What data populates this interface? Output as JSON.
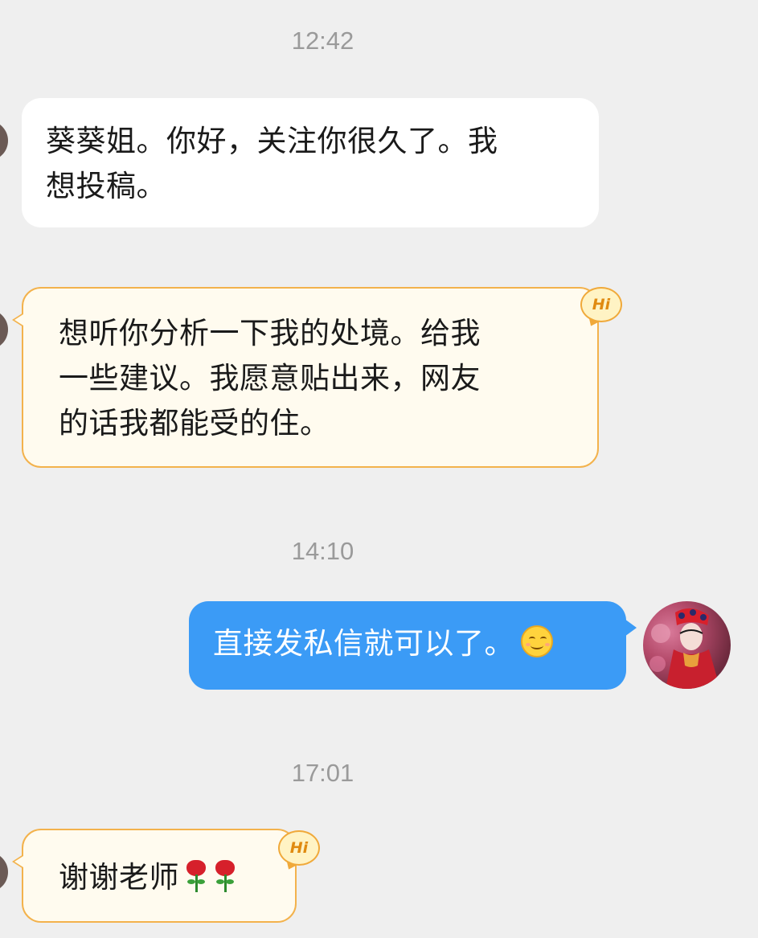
{
  "timestamps": [
    "12:42",
    "14:10",
    "17:01"
  ],
  "messages": [
    {
      "side": "left",
      "style": "white",
      "lines": [
        "葵葵姐。你好，关注你很久了。我",
        "想投稿。"
      ]
    },
    {
      "side": "left",
      "style": "cream",
      "badge": "Hi",
      "lines": [
        "想听你分析一下我的处境。给我",
        "一些建议。我愿意贴出来，网友",
        "的话我都能受的住。"
      ]
    },
    {
      "side": "right",
      "style": "blue",
      "text": "直接发私信就可以了。",
      "emoji": "smile-icon"
    },
    {
      "side": "left",
      "style": "cream",
      "badge": "Hi",
      "text": "谢谢老师",
      "emoji": "rose-icon"
    }
  ],
  "colors": {
    "background": "#efefef",
    "timestamp": "#9a9a9a",
    "bubble_white": "#ffffff",
    "bubble_cream": "#fffbef",
    "bubble_cream_border": "#f3b24c",
    "bubble_blue": "#3b9bf6",
    "badge_text": "#e08a10"
  }
}
